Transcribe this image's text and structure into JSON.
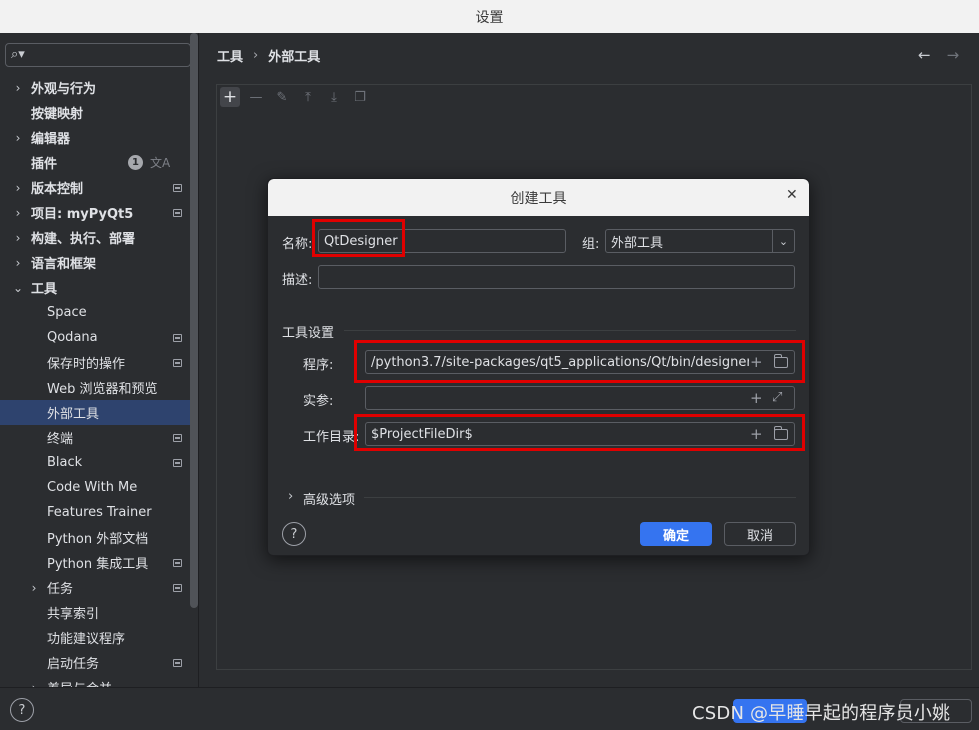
{
  "window": {
    "title": "设置"
  },
  "sidebar": {
    "search_placeholder": "",
    "items": [
      {
        "label": "外观与行为",
        "level": 0,
        "expandable": true
      },
      {
        "label": "按键映射",
        "level": 0,
        "expandable": false
      },
      {
        "label": "编辑器",
        "level": 0,
        "expandable": true
      },
      {
        "label": "插件",
        "level": 0,
        "expandable": false,
        "count": "1"
      },
      {
        "label": "版本控制",
        "level": 0,
        "expandable": true
      },
      {
        "label": "项目: myPyQt5",
        "level": 0,
        "expandable": true
      },
      {
        "label": "构建、执行、部署",
        "level": 0,
        "expandable": true
      },
      {
        "label": "语言和框架",
        "level": 0,
        "expandable": true
      },
      {
        "label": "工具",
        "level": 0,
        "expandable": true,
        "expanded": true
      },
      {
        "label": "Space",
        "level": 1
      },
      {
        "label": "Qodana",
        "level": 1
      },
      {
        "label": "保存时的操作",
        "level": 1
      },
      {
        "label": "Web 浏览器和预览",
        "level": 1
      },
      {
        "label": "外部工具",
        "level": 1,
        "selected": true
      },
      {
        "label": "终端",
        "level": 1
      },
      {
        "label": "Black",
        "level": 1
      },
      {
        "label": "Code With Me",
        "level": 1
      },
      {
        "label": "Features Trainer",
        "level": 1
      },
      {
        "label": "Python 外部文档",
        "level": 1
      },
      {
        "label": "Python 集成工具",
        "level": 1
      },
      {
        "label": "任务",
        "level": 1,
        "expandable": true
      },
      {
        "label": "共享索引",
        "level": 1
      },
      {
        "label": "功能建议程序",
        "level": 1
      },
      {
        "label": "启动任务",
        "level": 1
      },
      {
        "label": "差异与合并",
        "level": 1,
        "expandable": true
      }
    ]
  },
  "breadcrumb": {
    "parent": "工具",
    "separator": "›",
    "current": "外部工具"
  },
  "dialog": {
    "title": "创建工具",
    "name_label": "名称:",
    "name_value": "QtDesigner",
    "group_label": "组:",
    "group_value": "外部工具",
    "desc_label": "描述:",
    "desc_value": "",
    "section_title": "工具设置",
    "program_label": "程序:",
    "program_value": "/python3.7/site-packages/qt5_applications/Qt/bin/designer",
    "args_label": "实参:",
    "args_value": "",
    "workdir_label": "工作目录:",
    "workdir_value": "$ProjectFileDir$",
    "advanced_label": "高级选项",
    "ok_label": "确定",
    "cancel_label": "取消"
  },
  "watermark": "CSDN @早睡早起的程序员小姚",
  "colors": {
    "accent": "#3574f0",
    "annotation": "#e00000",
    "selection": "#2e436e",
    "background": "#2b2d30"
  }
}
